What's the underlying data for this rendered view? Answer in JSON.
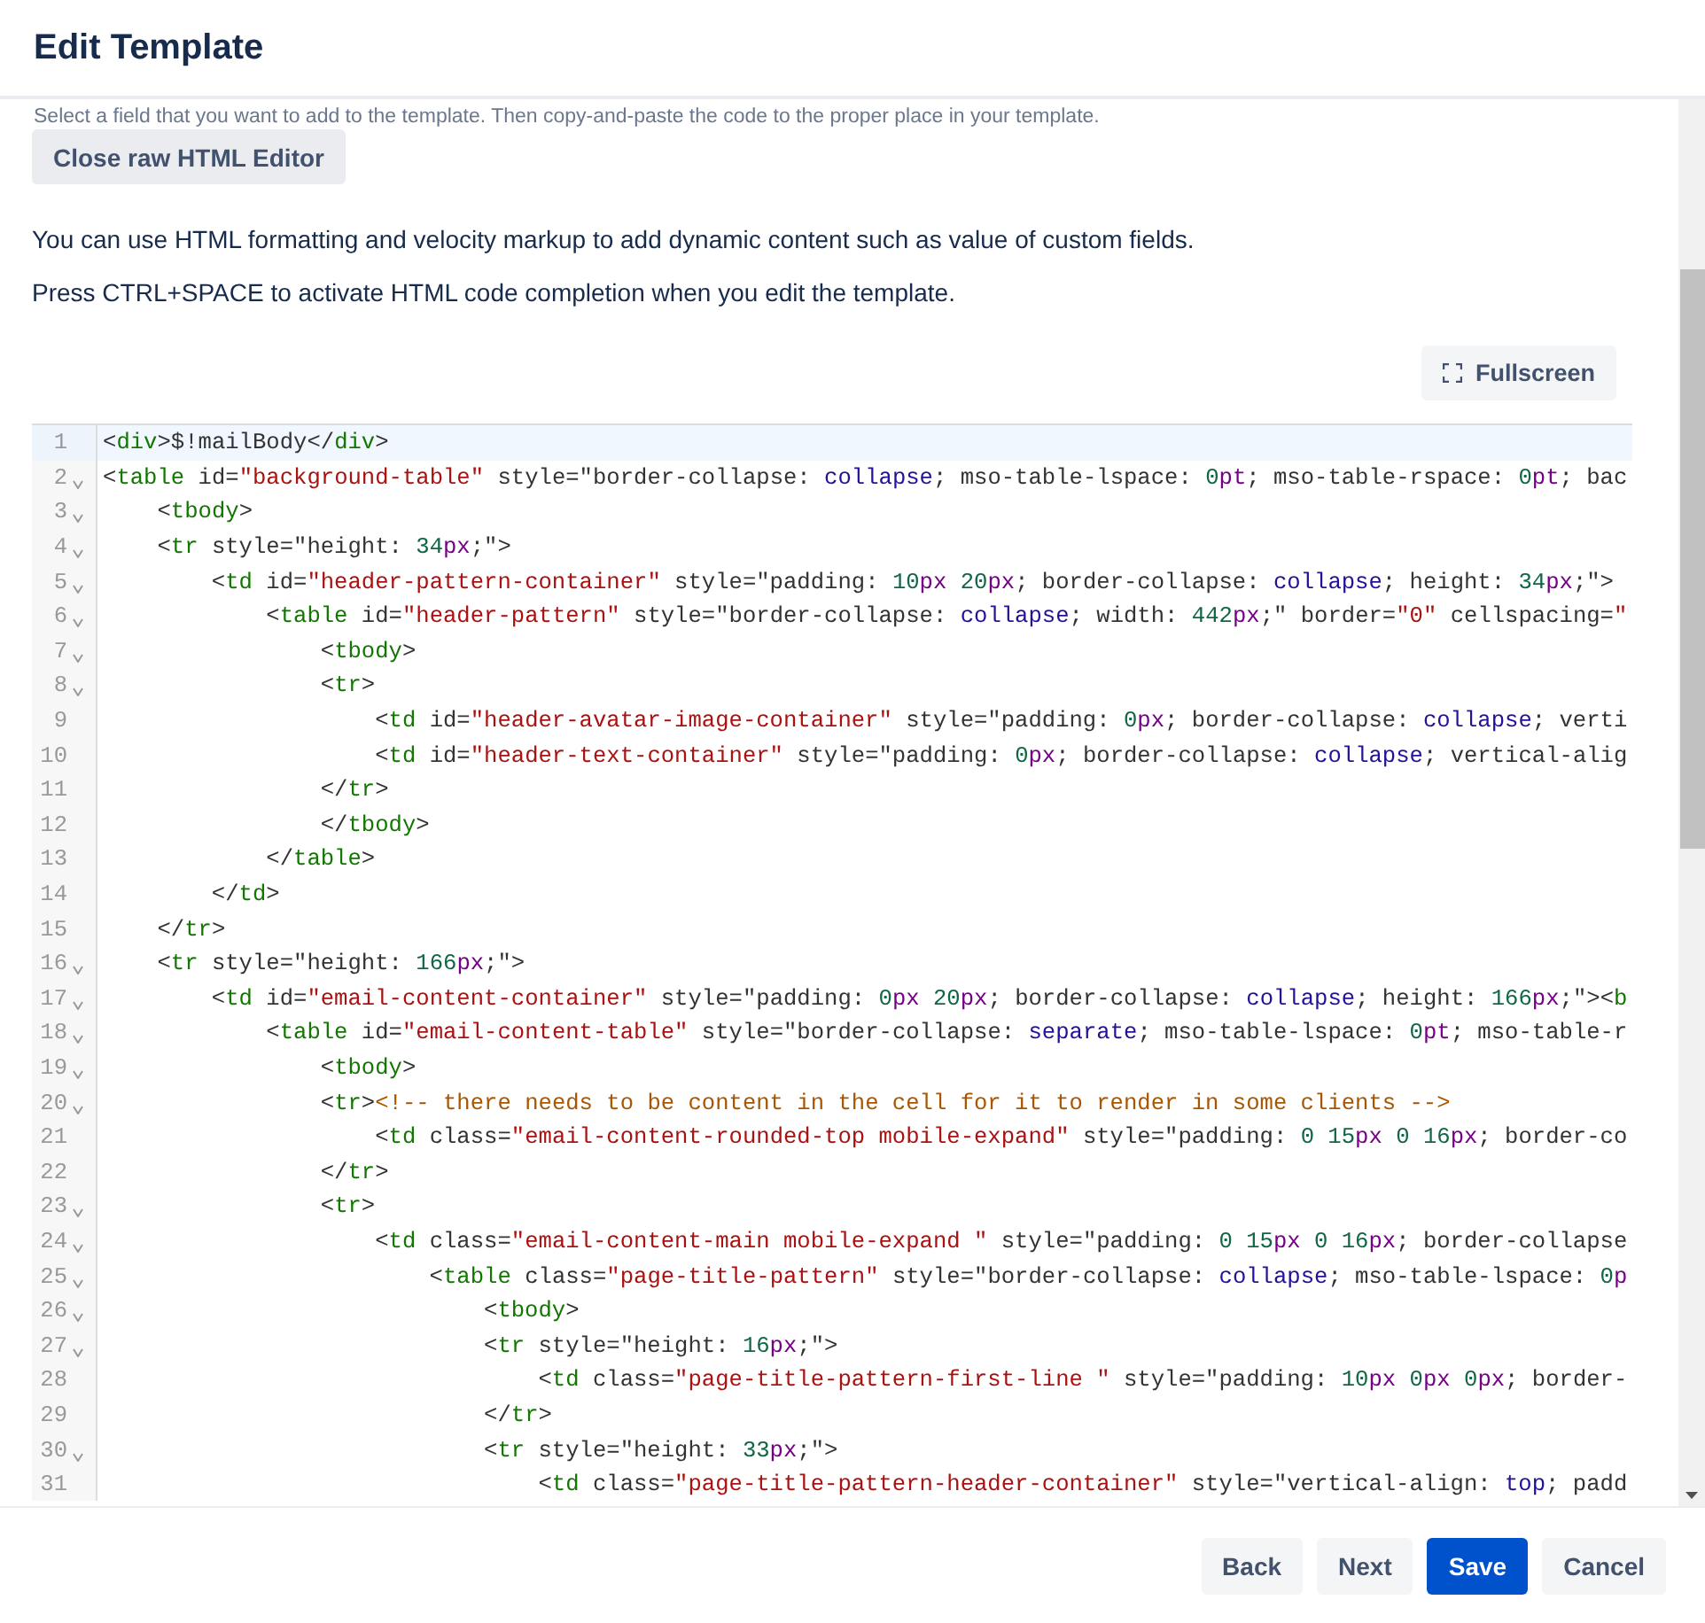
{
  "dialog": {
    "title": "Edit Template"
  },
  "hint": "Select a field that you want to add to the template. Then copy-and-paste the code to the proper place in your template.",
  "close_editor_button": "Close raw HTML Editor",
  "paragraphs": [
    "You can use HTML formatting and velocity markup to add dynamic content such as value of custom fields.",
    "Press CTRL+SPACE to activate HTML code completion when you edit the template."
  ],
  "fullscreen_button": "Fullscreen",
  "editor": {
    "lines": [
      {
        "number": "1",
        "foldable": false,
        "selected": true,
        "tokens": [
          {
            "kind": "text",
            "text": "<"
          },
          {
            "kind": "tag",
            "text": "div"
          },
          {
            "kind": "text",
            "text": ">$!mailBody</"
          },
          {
            "kind": "tag",
            "text": "div"
          },
          {
            "kind": "text",
            "text": ">"
          }
        ]
      },
      {
        "number": "2",
        "foldable": true,
        "selected": false,
        "tokens": [
          {
            "kind": "text",
            "text": "<"
          },
          {
            "kind": "tag",
            "text": "table"
          },
          {
            "kind": "text",
            "text": " id="
          },
          {
            "kind": "string",
            "text": "\"background-table\""
          },
          {
            "kind": "text",
            "text": " style=\"border-collapse: "
          },
          {
            "kind": "atom",
            "text": "collapse"
          },
          {
            "kind": "text",
            "text": "; mso-table-lspace: "
          },
          {
            "kind": "number",
            "text": "0"
          },
          {
            "kind": "unit",
            "text": "pt"
          },
          {
            "kind": "text",
            "text": "; mso-table-rspace: "
          },
          {
            "kind": "number",
            "text": "0"
          },
          {
            "kind": "unit",
            "text": "pt"
          },
          {
            "kind": "text",
            "text": "; bac"
          }
        ]
      },
      {
        "number": "3",
        "foldable": true,
        "selected": false,
        "tokens": [
          {
            "kind": "text",
            "text": "    <"
          },
          {
            "kind": "tag",
            "text": "tbody"
          },
          {
            "kind": "text",
            "text": ">"
          }
        ]
      },
      {
        "number": "4",
        "foldable": true,
        "selected": false,
        "tokens": [
          {
            "kind": "text",
            "text": "    <"
          },
          {
            "kind": "tag",
            "text": "tr"
          },
          {
            "kind": "text",
            "text": " style=\"height: "
          },
          {
            "kind": "number",
            "text": "34"
          },
          {
            "kind": "unit",
            "text": "px"
          },
          {
            "kind": "text",
            "text": ";\">"
          }
        ]
      },
      {
        "number": "5",
        "foldable": true,
        "selected": false,
        "tokens": [
          {
            "kind": "text",
            "text": "        <"
          },
          {
            "kind": "tag",
            "text": "td"
          },
          {
            "kind": "text",
            "text": " id="
          },
          {
            "kind": "string",
            "text": "\"header-pattern-container\""
          },
          {
            "kind": "text",
            "text": " style=\"padding: "
          },
          {
            "kind": "number",
            "text": "10"
          },
          {
            "kind": "unit",
            "text": "px "
          },
          {
            "kind": "number",
            "text": "20"
          },
          {
            "kind": "unit",
            "text": "px"
          },
          {
            "kind": "text",
            "text": "; border-collapse: "
          },
          {
            "kind": "atom",
            "text": "collapse"
          },
          {
            "kind": "text",
            "text": "; height: "
          },
          {
            "kind": "number",
            "text": "34"
          },
          {
            "kind": "unit",
            "text": "px"
          },
          {
            "kind": "text",
            "text": ";\">"
          }
        ]
      },
      {
        "number": "6",
        "foldable": true,
        "selected": false,
        "tokens": [
          {
            "kind": "text",
            "text": "            <"
          },
          {
            "kind": "tag",
            "text": "table"
          },
          {
            "kind": "text",
            "text": " id="
          },
          {
            "kind": "string",
            "text": "\"header-pattern\""
          },
          {
            "kind": "text",
            "text": " style=\"border-collapse: "
          },
          {
            "kind": "atom",
            "text": "collapse"
          },
          {
            "kind": "text",
            "text": "; width: "
          },
          {
            "kind": "number",
            "text": "442"
          },
          {
            "kind": "unit",
            "text": "px"
          },
          {
            "kind": "text",
            "text": ";\" border="
          },
          {
            "kind": "string",
            "text": "\"0\""
          },
          {
            "kind": "text",
            "text": " cellspacing="
          },
          {
            "kind": "string",
            "text": "\""
          }
        ]
      },
      {
        "number": "7",
        "foldable": true,
        "selected": false,
        "tokens": [
          {
            "kind": "text",
            "text": "                <"
          },
          {
            "kind": "tag",
            "text": "tbody"
          },
          {
            "kind": "text",
            "text": ">"
          }
        ]
      },
      {
        "number": "8",
        "foldable": true,
        "selected": false,
        "tokens": [
          {
            "kind": "text",
            "text": "                <"
          },
          {
            "kind": "tag",
            "text": "tr"
          },
          {
            "kind": "text",
            "text": ">"
          }
        ]
      },
      {
        "number": "9",
        "foldable": false,
        "selected": false,
        "tokens": [
          {
            "kind": "text",
            "text": "                    <"
          },
          {
            "kind": "tag",
            "text": "td"
          },
          {
            "kind": "text",
            "text": " id="
          },
          {
            "kind": "string",
            "text": "\"header-avatar-image-container\""
          },
          {
            "kind": "text",
            "text": " style=\"padding: "
          },
          {
            "kind": "number",
            "text": "0"
          },
          {
            "kind": "unit",
            "text": "px"
          },
          {
            "kind": "text",
            "text": "; border-collapse: "
          },
          {
            "kind": "atom",
            "text": "collapse"
          },
          {
            "kind": "text",
            "text": "; verti"
          }
        ]
      },
      {
        "number": "10",
        "foldable": false,
        "selected": false,
        "tokens": [
          {
            "kind": "text",
            "text": "                    <"
          },
          {
            "kind": "tag",
            "text": "td"
          },
          {
            "kind": "text",
            "text": " id="
          },
          {
            "kind": "string",
            "text": "\"header-text-container\""
          },
          {
            "kind": "text",
            "text": " style=\"padding: "
          },
          {
            "kind": "number",
            "text": "0"
          },
          {
            "kind": "unit",
            "text": "px"
          },
          {
            "kind": "text",
            "text": "; border-collapse: "
          },
          {
            "kind": "atom",
            "text": "collapse"
          },
          {
            "kind": "text",
            "text": "; vertical-alig"
          }
        ]
      },
      {
        "number": "11",
        "foldable": false,
        "selected": false,
        "tokens": [
          {
            "kind": "text",
            "text": "                </"
          },
          {
            "kind": "tag",
            "text": "tr"
          },
          {
            "kind": "text",
            "text": ">"
          }
        ]
      },
      {
        "number": "12",
        "foldable": false,
        "selected": false,
        "tokens": [
          {
            "kind": "text",
            "text": "                </"
          },
          {
            "kind": "tag",
            "text": "tbody"
          },
          {
            "kind": "text",
            "text": ">"
          }
        ]
      },
      {
        "number": "13",
        "foldable": false,
        "selected": false,
        "tokens": [
          {
            "kind": "text",
            "text": "            </"
          },
          {
            "kind": "tag",
            "text": "table"
          },
          {
            "kind": "text",
            "text": ">"
          }
        ]
      },
      {
        "number": "14",
        "foldable": false,
        "selected": false,
        "tokens": [
          {
            "kind": "text",
            "text": "        </"
          },
          {
            "kind": "tag",
            "text": "td"
          },
          {
            "kind": "text",
            "text": ">"
          }
        ]
      },
      {
        "number": "15",
        "foldable": false,
        "selected": false,
        "tokens": [
          {
            "kind": "text",
            "text": "    </"
          },
          {
            "kind": "tag",
            "text": "tr"
          },
          {
            "kind": "text",
            "text": ">"
          }
        ]
      },
      {
        "number": "16",
        "foldable": true,
        "selected": false,
        "tokens": [
          {
            "kind": "text",
            "text": "    <"
          },
          {
            "kind": "tag",
            "text": "tr"
          },
          {
            "kind": "text",
            "text": " style=\"height: "
          },
          {
            "kind": "number",
            "text": "166"
          },
          {
            "kind": "unit",
            "text": "px"
          },
          {
            "kind": "text",
            "text": ";\">"
          }
        ]
      },
      {
        "number": "17",
        "foldable": true,
        "selected": false,
        "tokens": [
          {
            "kind": "text",
            "text": "        <"
          },
          {
            "kind": "tag",
            "text": "td"
          },
          {
            "kind": "text",
            "text": " id="
          },
          {
            "kind": "string",
            "text": "\"email-content-container\""
          },
          {
            "kind": "text",
            "text": " style=\"padding: "
          },
          {
            "kind": "number",
            "text": "0"
          },
          {
            "kind": "unit",
            "text": "px "
          },
          {
            "kind": "number",
            "text": "20"
          },
          {
            "kind": "unit",
            "text": "px"
          },
          {
            "kind": "text",
            "text": "; border-collapse: "
          },
          {
            "kind": "atom",
            "text": "collapse"
          },
          {
            "kind": "text",
            "text": "; height: "
          },
          {
            "kind": "number",
            "text": "166"
          },
          {
            "kind": "unit",
            "text": "px"
          },
          {
            "kind": "text",
            "text": ";\"><"
          },
          {
            "kind": "tag",
            "text": "b"
          }
        ]
      },
      {
        "number": "18",
        "foldable": true,
        "selected": false,
        "tokens": [
          {
            "kind": "text",
            "text": "            <"
          },
          {
            "kind": "tag",
            "text": "table"
          },
          {
            "kind": "text",
            "text": " id="
          },
          {
            "kind": "string",
            "text": "\"email-content-table\""
          },
          {
            "kind": "text",
            "text": " style=\"border-collapse: "
          },
          {
            "kind": "atom",
            "text": "separate"
          },
          {
            "kind": "text",
            "text": "; mso-table-lspace: "
          },
          {
            "kind": "number",
            "text": "0"
          },
          {
            "kind": "unit",
            "text": "pt"
          },
          {
            "kind": "text",
            "text": "; mso-table-r"
          }
        ]
      },
      {
        "number": "19",
        "foldable": true,
        "selected": false,
        "tokens": [
          {
            "kind": "text",
            "text": "                <"
          },
          {
            "kind": "tag",
            "text": "tbody"
          },
          {
            "kind": "text",
            "text": ">"
          }
        ]
      },
      {
        "number": "20",
        "foldable": true,
        "selected": false,
        "tokens": [
          {
            "kind": "text",
            "text": "                <"
          },
          {
            "kind": "tag",
            "text": "tr"
          },
          {
            "kind": "text",
            "text": ">"
          },
          {
            "kind": "comment",
            "text": "<!-- there needs to be content in the cell for it to render in some clients -->"
          }
        ]
      },
      {
        "number": "21",
        "foldable": false,
        "selected": false,
        "tokens": [
          {
            "kind": "text",
            "text": "                    <"
          },
          {
            "kind": "tag",
            "text": "td"
          },
          {
            "kind": "text",
            "text": " class="
          },
          {
            "kind": "string",
            "text": "\"email-content-rounded-top mobile-expand\""
          },
          {
            "kind": "text",
            "text": " style=\"padding: "
          },
          {
            "kind": "number",
            "text": "0 15"
          },
          {
            "kind": "unit",
            "text": "px "
          },
          {
            "kind": "number",
            "text": "0 16"
          },
          {
            "kind": "unit",
            "text": "px"
          },
          {
            "kind": "text",
            "text": "; border-co"
          }
        ]
      },
      {
        "number": "22",
        "foldable": false,
        "selected": false,
        "tokens": [
          {
            "kind": "text",
            "text": "                </"
          },
          {
            "kind": "tag",
            "text": "tr"
          },
          {
            "kind": "text",
            "text": ">"
          }
        ]
      },
      {
        "number": "23",
        "foldable": true,
        "selected": false,
        "tokens": [
          {
            "kind": "text",
            "text": "                <"
          },
          {
            "kind": "tag",
            "text": "tr"
          },
          {
            "kind": "text",
            "text": ">"
          }
        ]
      },
      {
        "number": "24",
        "foldable": true,
        "selected": false,
        "tokens": [
          {
            "kind": "text",
            "text": "                    <"
          },
          {
            "kind": "tag",
            "text": "td"
          },
          {
            "kind": "text",
            "text": " class="
          },
          {
            "kind": "string",
            "text": "\"email-content-main mobile-expand \""
          },
          {
            "kind": "text",
            "text": " style=\"padding: "
          },
          {
            "kind": "number",
            "text": "0 15"
          },
          {
            "kind": "unit",
            "text": "px "
          },
          {
            "kind": "number",
            "text": "0 16"
          },
          {
            "kind": "unit",
            "text": "px"
          },
          {
            "kind": "text",
            "text": "; border-collapse"
          }
        ]
      },
      {
        "number": "25",
        "foldable": true,
        "selected": false,
        "tokens": [
          {
            "kind": "text",
            "text": "                        <"
          },
          {
            "kind": "tag",
            "text": "table"
          },
          {
            "kind": "text",
            "text": " class="
          },
          {
            "kind": "string",
            "text": "\"page-title-pattern\""
          },
          {
            "kind": "text",
            "text": " style=\"border-collapse: "
          },
          {
            "kind": "atom",
            "text": "collapse"
          },
          {
            "kind": "text",
            "text": "; mso-table-lspace: "
          },
          {
            "kind": "number",
            "text": "0"
          },
          {
            "kind": "unit",
            "text": "p"
          }
        ]
      },
      {
        "number": "26",
        "foldable": true,
        "selected": false,
        "tokens": [
          {
            "kind": "text",
            "text": "                            <"
          },
          {
            "kind": "tag",
            "text": "tbody"
          },
          {
            "kind": "text",
            "text": ">"
          }
        ]
      },
      {
        "number": "27",
        "foldable": true,
        "selected": false,
        "tokens": [
          {
            "kind": "text",
            "text": "                            <"
          },
          {
            "kind": "tag",
            "text": "tr"
          },
          {
            "kind": "text",
            "text": " style=\"height: "
          },
          {
            "kind": "number",
            "text": "16"
          },
          {
            "kind": "unit",
            "text": "px"
          },
          {
            "kind": "text",
            "text": ";\">"
          }
        ]
      },
      {
        "number": "28",
        "foldable": false,
        "selected": false,
        "tokens": [
          {
            "kind": "text",
            "text": "                                <"
          },
          {
            "kind": "tag",
            "text": "td"
          },
          {
            "kind": "text",
            "text": " class="
          },
          {
            "kind": "string",
            "text": "\"page-title-pattern-first-line \""
          },
          {
            "kind": "text",
            "text": " style=\"padding: "
          },
          {
            "kind": "number",
            "text": "10"
          },
          {
            "kind": "unit",
            "text": "px "
          },
          {
            "kind": "number",
            "text": "0"
          },
          {
            "kind": "unit",
            "text": "px "
          },
          {
            "kind": "number",
            "text": "0"
          },
          {
            "kind": "unit",
            "text": "px"
          },
          {
            "kind": "text",
            "text": "; border-"
          }
        ]
      },
      {
        "number": "29",
        "foldable": false,
        "selected": false,
        "tokens": [
          {
            "kind": "text",
            "text": "                            </"
          },
          {
            "kind": "tag",
            "text": "tr"
          },
          {
            "kind": "text",
            "text": ">"
          }
        ]
      },
      {
        "number": "30",
        "foldable": true,
        "selected": false,
        "tokens": [
          {
            "kind": "text",
            "text": "                            <"
          },
          {
            "kind": "tag",
            "text": "tr"
          },
          {
            "kind": "text",
            "text": " style=\"height: "
          },
          {
            "kind": "number",
            "text": "33"
          },
          {
            "kind": "unit",
            "text": "px"
          },
          {
            "kind": "text",
            "text": ";\">"
          }
        ]
      },
      {
        "number": "31",
        "foldable": false,
        "selected": false,
        "tokens": [
          {
            "kind": "text",
            "text": "                                <"
          },
          {
            "kind": "tag",
            "text": "td"
          },
          {
            "kind": "text",
            "text": " class="
          },
          {
            "kind": "string",
            "text": "\"page-title-pattern-header-container\""
          },
          {
            "kind": "text",
            "text": " style=\"vertical-align: "
          },
          {
            "kind": "atom",
            "text": "top"
          },
          {
            "kind": "text",
            "text": "; padd"
          }
        ]
      }
    ]
  },
  "footer_buttons": [
    {
      "label": "Back",
      "kind": "secondary"
    },
    {
      "label": "Next",
      "kind": "secondary"
    },
    {
      "label": "Save",
      "kind": "primary"
    },
    {
      "label": "Cancel",
      "kind": "secondary"
    }
  ]
}
